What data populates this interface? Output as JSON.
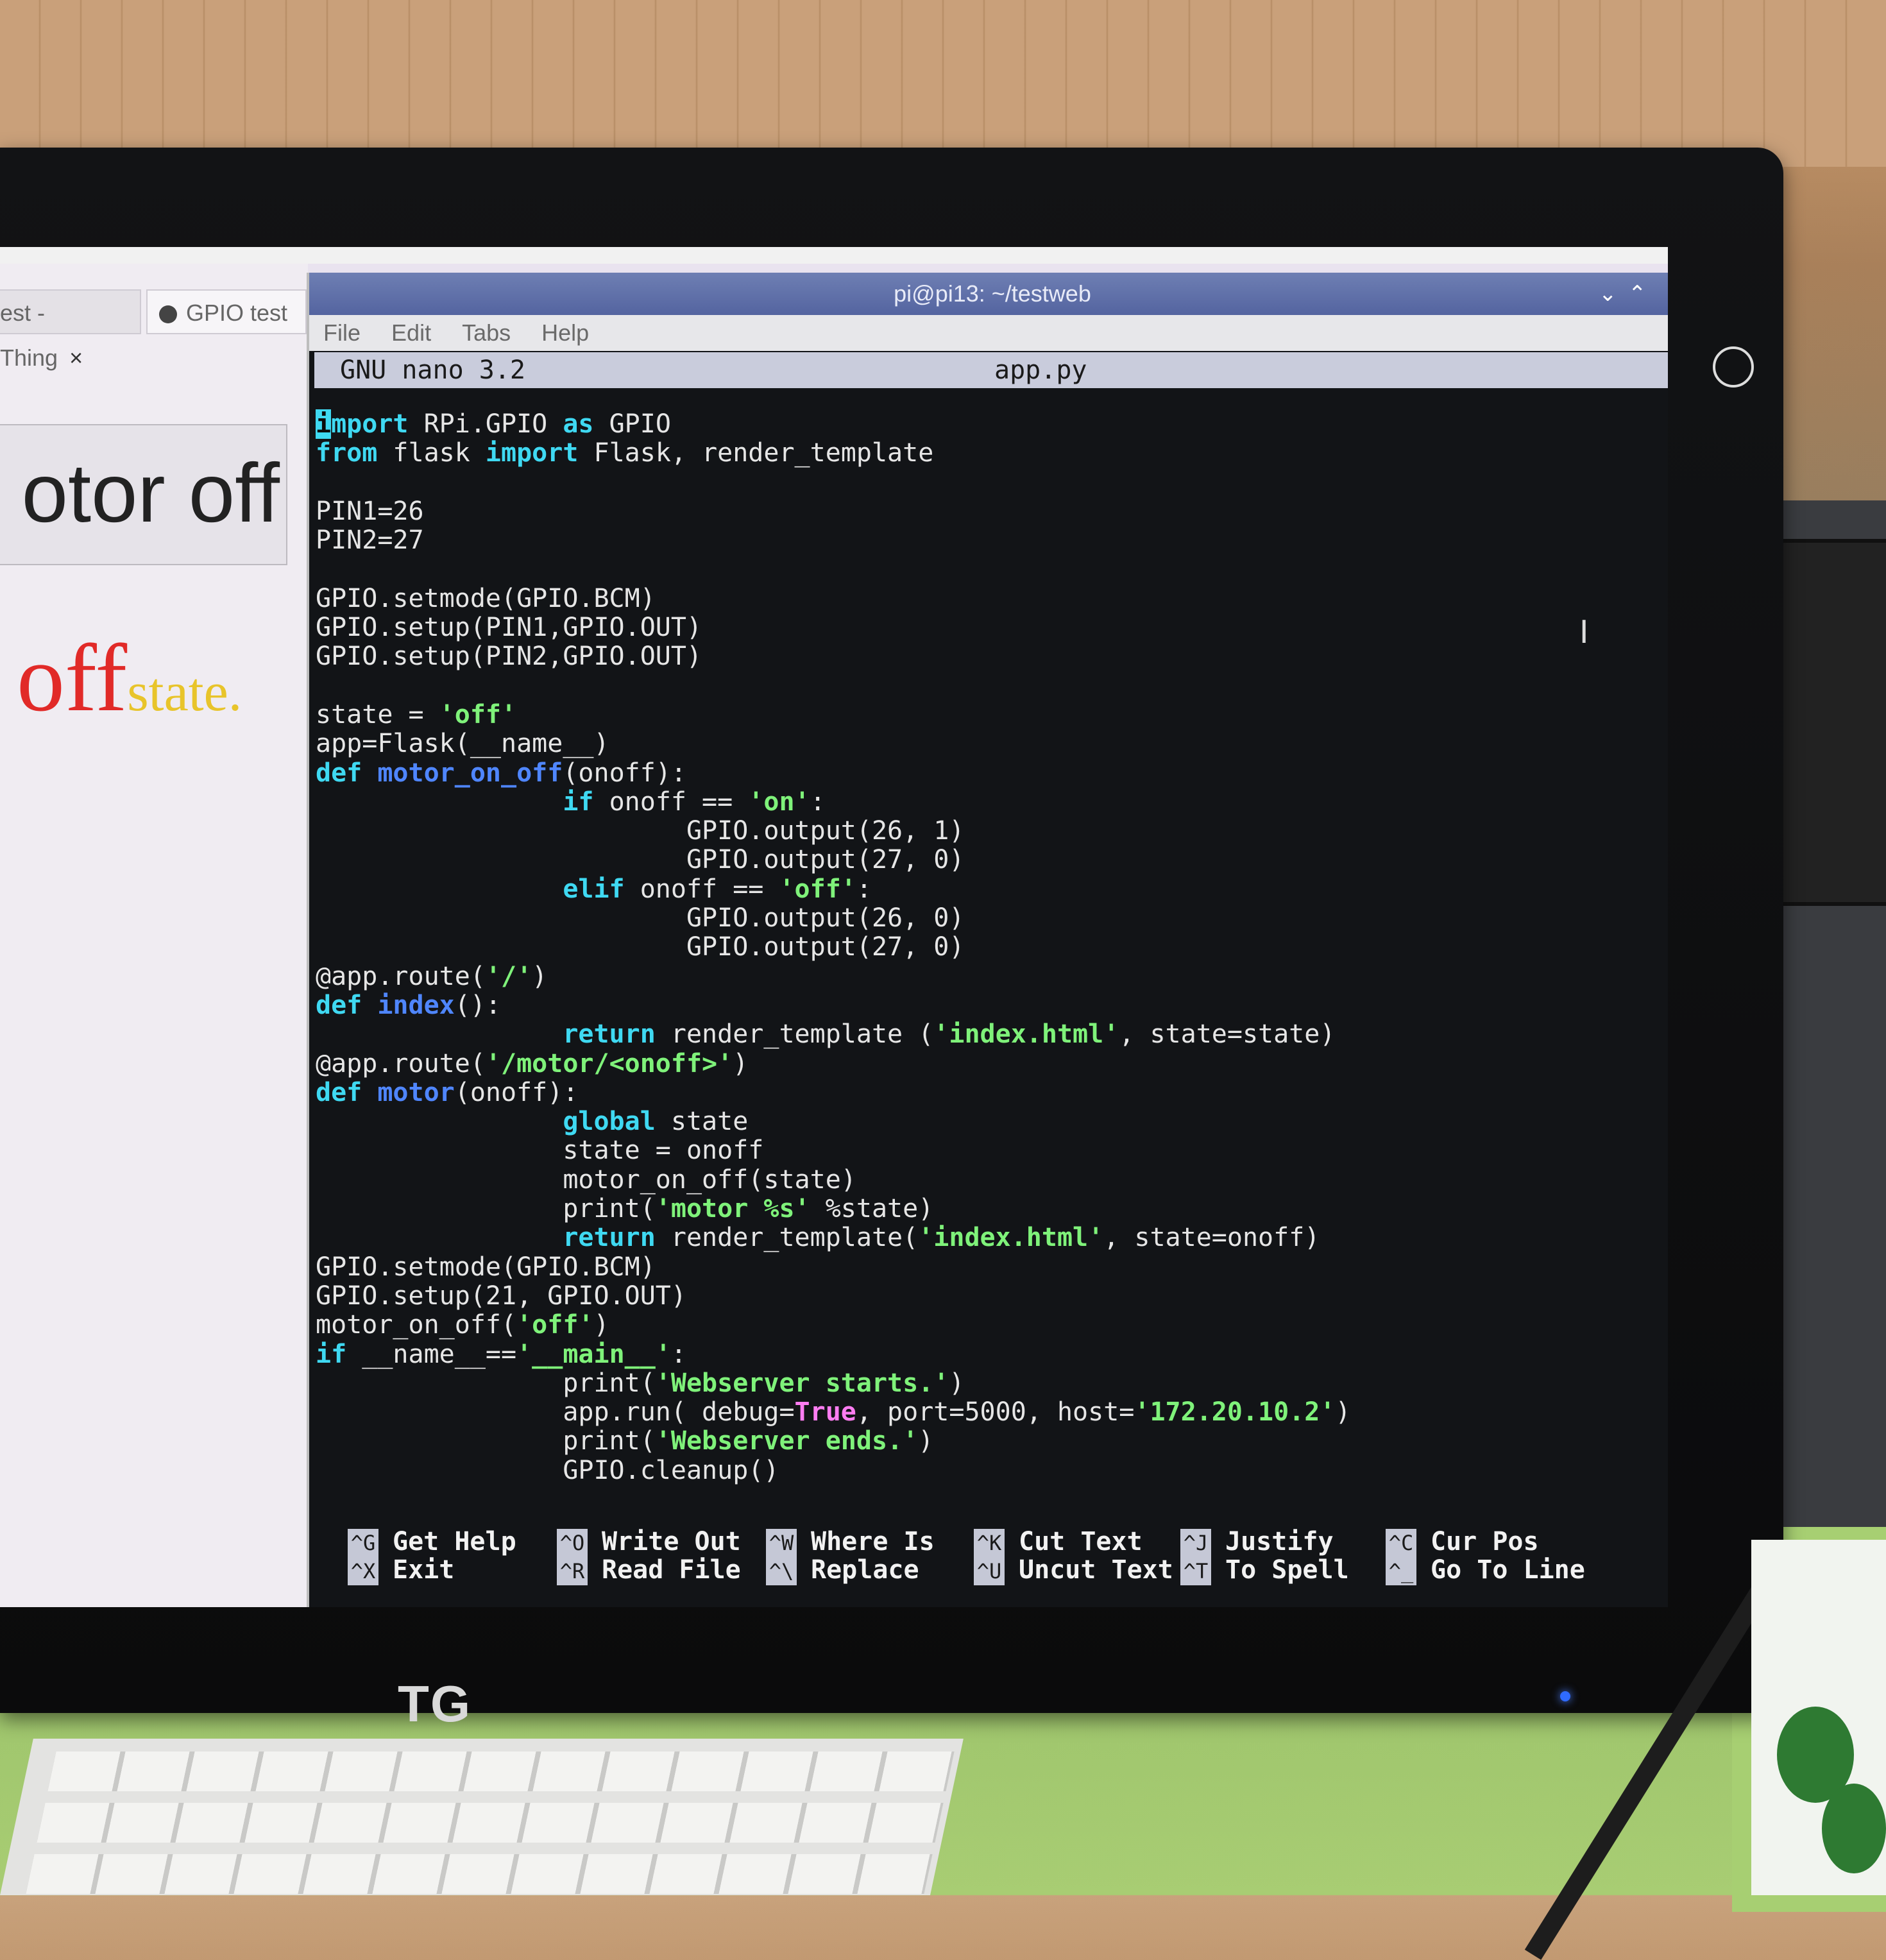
{
  "window": {
    "title": "pi@pi13: ~/testweb"
  },
  "menu": [
    "File",
    "Edit",
    "Tabs",
    "Help"
  ],
  "nano": {
    "version": "GNU nano 3.2",
    "filename": "app.py"
  },
  "browser": {
    "tabs": [
      {
        "label": "est - Thing",
        "close": "×"
      },
      {
        "label": "GPIO test"
      }
    ],
    "button_text": "otor off",
    "state_big": "off",
    "state_small": "state."
  },
  "code_lines": [
    "import RPi.GPIO as GPIO",
    "from flask import Flask, render_template",
    "",
    "PIN1=26",
    "PIN2=27",
    "",
    "GPIO.setmode(GPIO.BCM)",
    "GPIO.setup(PIN1,GPIO.OUT)",
    "GPIO.setup(PIN2,GPIO.OUT)",
    "",
    "state = 'off'",
    "app=Flask(__name__)",
    "def motor_on_off(onoff):",
    "                if onoff == 'on':",
    "                        GPIO.output(26, 1)",
    "                        GPIO.output(27, 0)",
    "                elif onoff == 'off':",
    "                        GPIO.output(26, 0)",
    "                        GPIO.output(27, 0)",
    "@app.route('/')",
    "def index():",
    "                return render_template ('index.html', state=state)",
    "@app.route('/motor/<onoff>')",
    "def motor(onoff):",
    "                global state",
    "                state = onoff",
    "                motor_on_off(state)",
    "                print('motor %s' %state)",
    "                return render_template('index.html', state=onoff)",
    "GPIO.setmode(GPIO.BCM)",
    "GPIO.setup(21, GPIO.OUT)",
    "motor_on_off('off')",
    "if __name__=='__main__':",
    "                print('Webserver starts.')",
    "                app.run( debug=True, port=5000, host='172.20.10.2')",
    "                print('Webserver ends.')",
    "                GPIO.cleanup()"
  ],
  "shortcuts": [
    {
      "key": "^G",
      "label": "Get Help"
    },
    {
      "key": "^O",
      "label": "Write Out"
    },
    {
      "key": "^W",
      "label": "Where Is"
    },
    {
      "key": "^K",
      "label": "Cut Text"
    },
    {
      "key": "^J",
      "label": "Justify"
    },
    {
      "key": "^C",
      "label": "Cur Pos"
    },
    {
      "key": "^X",
      "label": "Exit"
    },
    {
      "key": "^R",
      "label": "Read File"
    },
    {
      "key": "^\\",
      "label": "Replace"
    },
    {
      "key": "^U",
      "label": "Uncut Text"
    },
    {
      "key": "^T",
      "label": "To Spell"
    },
    {
      "key": "^_",
      "label": "Go To Line"
    }
  ],
  "monitor": {
    "brand": "TG"
  },
  "colors": {
    "keyword": "#3fd9f2",
    "function": "#4f86ff",
    "string": "#7ff27a",
    "constant": "#ff7df2",
    "titlebar": "#5f6fa8"
  }
}
